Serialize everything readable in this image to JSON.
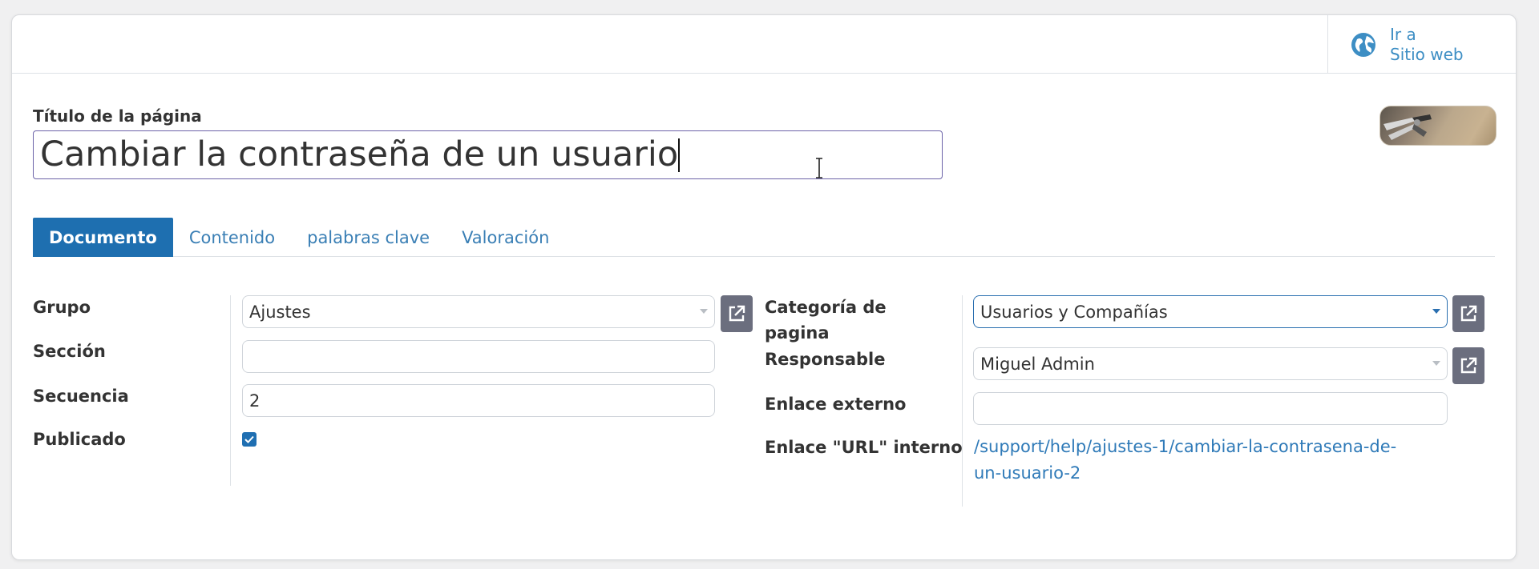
{
  "header": {
    "website_button": {
      "line1": "Ir a",
      "line2": "Sitio web",
      "icon": "globe-icon"
    }
  },
  "title": {
    "label": "Título de la página",
    "value": "Cambiar la contraseña de un usuario"
  },
  "tabs": [
    {
      "label": "Documento",
      "active": true
    },
    {
      "label": "Contenido",
      "active": false
    },
    {
      "label": "palabras clave",
      "active": false
    },
    {
      "label": "Valoración",
      "active": false
    }
  ],
  "left_fields": {
    "grupo": {
      "label": "Grupo",
      "value": "Ajustes"
    },
    "seccion": {
      "label": "Sección",
      "value": ""
    },
    "secuencia": {
      "label": "Secuencia",
      "value": "2"
    },
    "publicado": {
      "label": "Publicado",
      "checked": true
    }
  },
  "right_fields": {
    "categoria": {
      "label_line1": "Categoría de",
      "label_line2": "pagina",
      "value": "Usuarios y Compañías"
    },
    "responsable": {
      "label": "Responsable",
      "value": "Miguel Admin"
    },
    "enlace_externo": {
      "label": "Enlace externo",
      "value": ""
    },
    "enlace_interno": {
      "label": "Enlace \"URL\" interno",
      "line1": "/support/help/ajustes-1/cambiar-la-contrasena-de-",
      "line2": "un-usuario-2"
    }
  },
  "colors": {
    "accent": "#1e6fb0",
    "link": "#2f7ab8",
    "ext_button": "#6b6e7e"
  }
}
